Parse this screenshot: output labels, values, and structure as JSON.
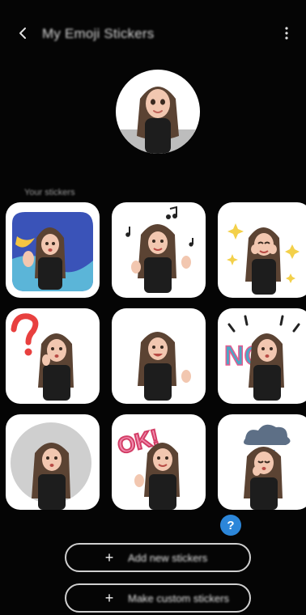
{
  "app_bar": {
    "title": "My Emoji Stickers",
    "back_icon": "chevron-left-icon",
    "more_icon": "more-vertical-icon"
  },
  "profile": {
    "icon": "avatar"
  },
  "section": {
    "label": "Your stickers"
  },
  "stickers": [
    {
      "name": "waving-night",
      "text": ""
    },
    {
      "name": "music-notes",
      "text": ""
    },
    {
      "name": "sparkles",
      "text": ""
    },
    {
      "name": "question",
      "text": ""
    },
    {
      "name": "smiling",
      "text": ""
    },
    {
      "name": "no",
      "text": "NO"
    },
    {
      "name": "gray-circle",
      "text": ""
    },
    {
      "name": "ok",
      "text": "OK!"
    },
    {
      "name": "cloud",
      "text": ""
    }
  ],
  "help": {
    "label": "?"
  },
  "buttons": {
    "add_new": {
      "plus": "+",
      "label": "Add new stickers"
    },
    "make_custom": {
      "plus": "+",
      "label": "Make custom stickers"
    }
  },
  "colors": {
    "background": "#050505",
    "tile_background": "#ffffff",
    "help_blue": "#2c86d9"
  }
}
